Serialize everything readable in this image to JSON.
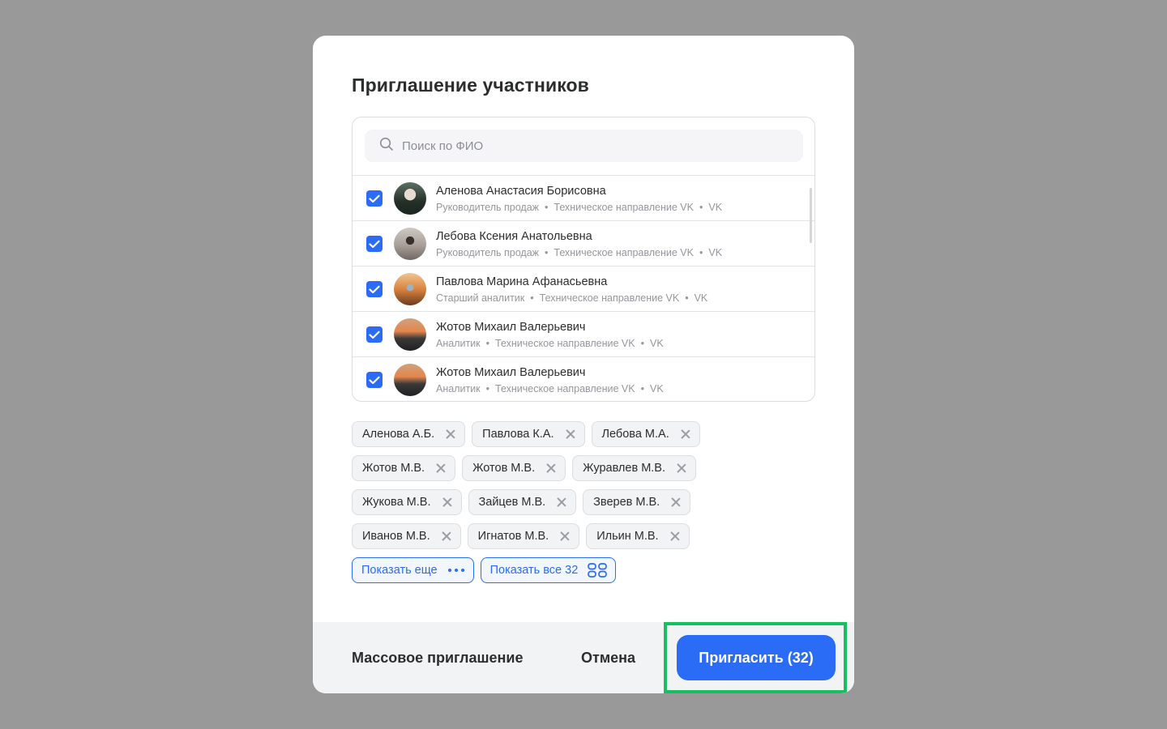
{
  "modal": {
    "title": "Приглашение участников",
    "search_placeholder": "Поиск по ФИО"
  },
  "people": [
    {
      "name": "Аленова Анастасия Борисовна",
      "role": "Руководитель продаж",
      "dept": "Техническое направление VK",
      "org": "VK",
      "checked": true
    },
    {
      "name": "Лебова Ксения Анатольевна",
      "role": "Руководитель продаж",
      "dept": "Техническое направление VK",
      "org": "VK",
      "checked": true
    },
    {
      "name": "Павлова Марина Афанасьевна",
      "role": "Старший аналитик",
      "dept": "Техническое направление VK",
      "org": "VK",
      "checked": true
    },
    {
      "name": "Жотов Михаил Валерьевич",
      "role": "Аналитик",
      "dept": "Техническое направление VK",
      "org": "VK",
      "checked": true
    },
    {
      "name": "Жотов Михаил Валерьевич",
      "role": "Аналитик",
      "dept": "Техническое направление VK",
      "org": "VK",
      "checked": true
    }
  ],
  "chips": [
    [
      "Аленова А.Б.",
      "Павлова К.А.",
      "Лебова М.А."
    ],
    [
      "Жотов М.В.",
      "Жотов М.В.",
      "Журавлев М.В."
    ],
    [
      "Жукова М.В.",
      "Зайцев М.В.",
      "Зверев М.В."
    ],
    [
      "Иванов М.В.",
      "Игнатов М.В.",
      "Ильин М.В."
    ]
  ],
  "show_more_label": "Показать еще",
  "show_all_label": "Показать все 32",
  "footer": {
    "mass_invite_label": "Массовое приглашение",
    "cancel_label": "Отмена",
    "invite_label": "Пригласить (32)"
  },
  "colors": {
    "accent": "#2a6cf5",
    "highlight": "#16c060"
  }
}
